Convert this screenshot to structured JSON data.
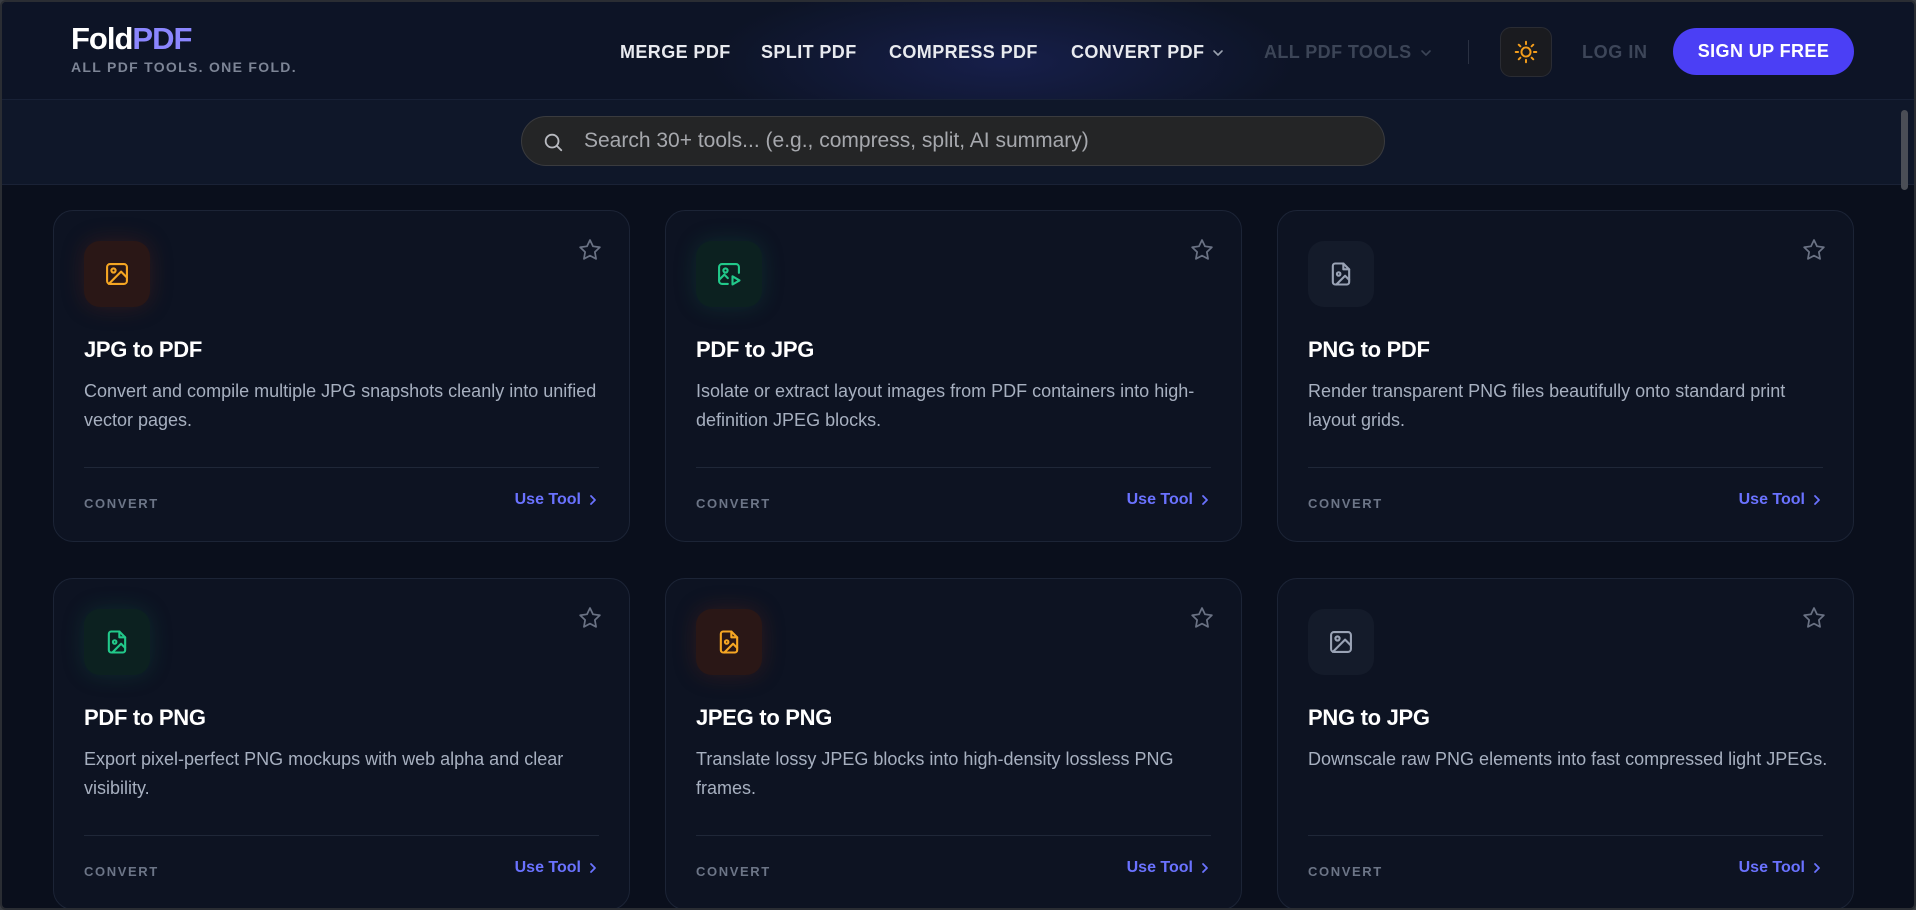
{
  "brand": {
    "name_part1": "Fold",
    "name_part2": "PDF",
    "tagline": "ALL PDF TOOLS. ONE FOLD."
  },
  "nav": {
    "items": [
      {
        "label": "MERGE PDF"
      },
      {
        "label": "SPLIT PDF"
      },
      {
        "label": "COMPRESS PDF"
      },
      {
        "label": "CONVERT PDF"
      },
      {
        "label": "ALL PDF TOOLS"
      }
    ],
    "login_label": "LOG IN",
    "signup_label": "SIGN UP FREE",
    "theme_icon": "sun-icon"
  },
  "search": {
    "placeholder": "Search 30+ tools... (e.g., compress, split, AI summary)",
    "value": ""
  },
  "colors": {
    "accent": "#4b3ff5",
    "link": "#6a72ff",
    "brand_accent": "#8b86ff",
    "icon_orange": "#f5a623",
    "icon_green": "#22c98a",
    "icon_gray": "#9aa3b5"
  },
  "tools": [
    {
      "title": "JPG to PDF",
      "desc": "Convert and compile multiple JPG snapshots cleanly into unified vector pages.",
      "category": "CONVERT",
      "cta": "Use Tool",
      "icon": "image-icon",
      "tone": "orange"
    },
    {
      "title": "PDF to JPG",
      "desc": "Isolate or extract layout images from PDF containers into high-definition JPEG blocks.",
      "category": "CONVERT",
      "cta": "Use Tool",
      "icon": "image-play-icon",
      "tone": "green"
    },
    {
      "title": "PNG to PDF",
      "desc": "Render transparent PNG files beautifully onto standard print layout grids.",
      "category": "CONVERT",
      "cta": "Use Tool",
      "icon": "file-image-icon",
      "tone": "gray"
    },
    {
      "title": "PDF to PNG",
      "desc": "Export pixel-perfect PNG mockups with web alpha and clear visibility.",
      "category": "CONVERT",
      "cta": "Use Tool",
      "icon": "file-image-icon",
      "tone": "green"
    },
    {
      "title": "JPEG to PNG",
      "desc": "Translate lossy JPEG blocks into high-density lossless PNG frames.",
      "category": "CONVERT",
      "cta": "Use Tool",
      "icon": "file-image-icon",
      "tone": "orange"
    },
    {
      "title": "PNG to JPG",
      "desc": "Downscale raw PNG elements into fast compressed light JPEGs.",
      "category": "CONVERT",
      "cta": "Use Tool",
      "icon": "image-icon",
      "tone": "gray"
    }
  ]
}
